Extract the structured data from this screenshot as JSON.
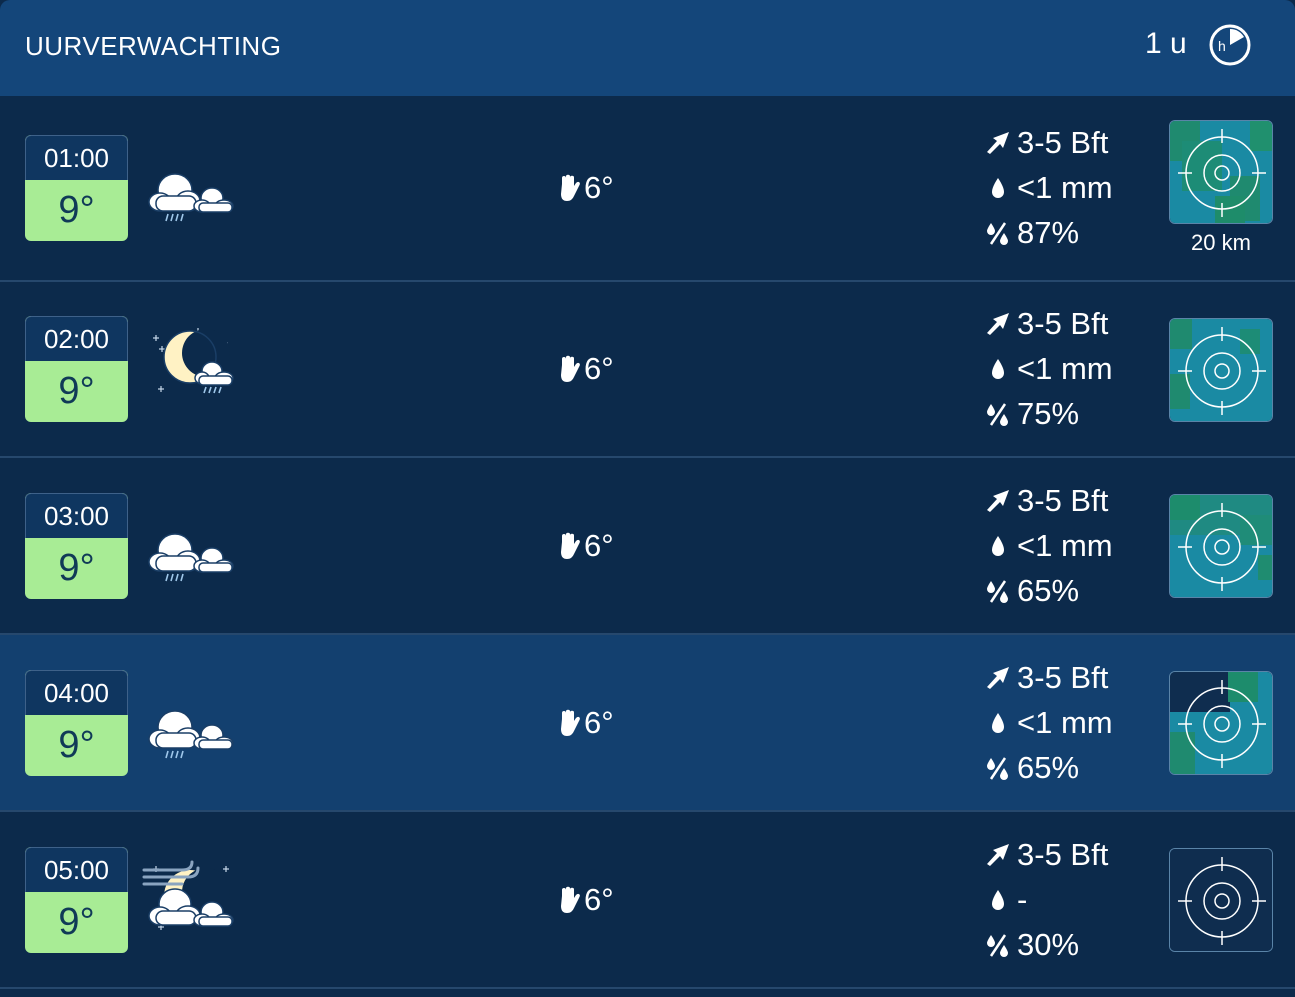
{
  "header": {
    "title": "UURVERWACHTING",
    "interval": "1 u",
    "interval_icon": "hourly-clock-icon"
  },
  "colors": {
    "header_bg": "#14467a",
    "row_bg": "#0c2a4b",
    "row_highlight_bg": "#13406f",
    "temp_bg": "#a8ec95",
    "temp_text": "#103a57"
  },
  "rows": [
    {
      "time": "01:00",
      "temp": "9°",
      "weather_icon": "cloud-rain-icon",
      "feels_like": "6°",
      "wind": "3-5 Bft",
      "precip": "<1 mm",
      "precip_chance": "87%",
      "radar_distance": "20 km"
    },
    {
      "time": "02:00",
      "temp": "9°",
      "weather_icon": "moon-cloud-rain-icon",
      "feels_like": "6°",
      "wind": "3-5 Bft",
      "precip": "<1 mm",
      "precip_chance": "75%"
    },
    {
      "time": "03:00",
      "temp": "9°",
      "weather_icon": "cloud-rain-icon",
      "feels_like": "6°",
      "wind": "3-5 Bft",
      "precip": "<1 mm",
      "precip_chance": "65%"
    },
    {
      "time": "04:00",
      "temp": "9°",
      "weather_icon": "cloud-rain-icon",
      "feels_like": "6°",
      "wind": "3-5 Bft",
      "precip": "<1 mm",
      "precip_chance": "65%"
    },
    {
      "time": "05:00",
      "temp": "9°",
      "weather_icon": "moon-cloud-wind-icon",
      "feels_like": "6°",
      "wind": "3-5 Bft",
      "precip": "-",
      "precip_chance": "30%"
    }
  ]
}
